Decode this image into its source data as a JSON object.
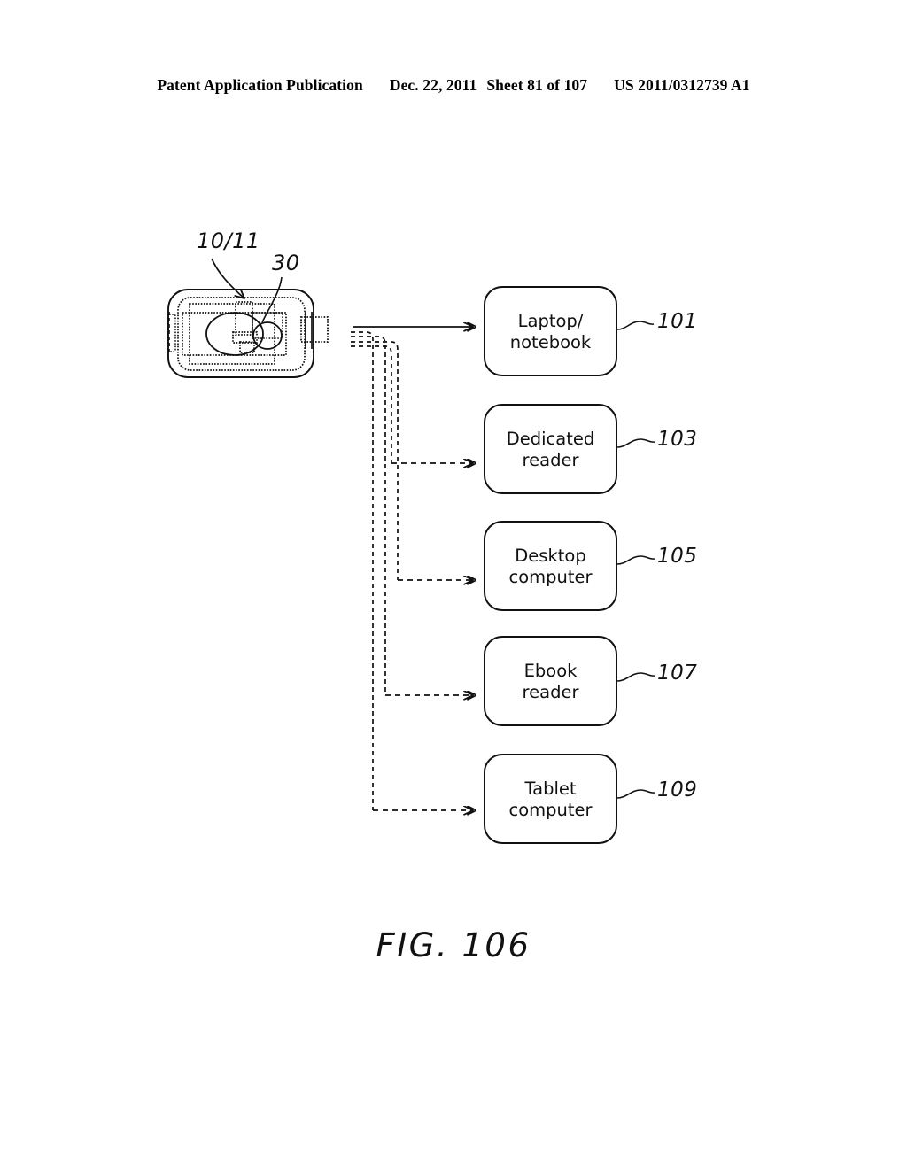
{
  "header": {
    "publication": "Patent Application Publication",
    "date": "Dec. 22, 2011",
    "sheet": "Sheet 81 of 107",
    "patent_number": "US 2011/0312739 A1"
  },
  "figure": {
    "caption": "FIG. 106",
    "source_device": {
      "ref_label": "10/11",
      "component_ref_label": "30",
      "name": "handheld-device"
    },
    "targets": [
      {
        "label": "Laptop/\nnotebook",
        "ref": "101",
        "link": "solid-arrow"
      },
      {
        "label": "Dedicated\nreader",
        "ref": "103",
        "link": "dashed-arrow"
      },
      {
        "label": "Desktop\ncomputer",
        "ref": "105",
        "link": "dashed-arrow"
      },
      {
        "label": "Ebook\nreader",
        "ref": "107",
        "link": "dashed-arrow"
      },
      {
        "label": "Tablet\ncomputer",
        "ref": "109",
        "link": "dashed-arrow"
      }
    ]
  },
  "colors": {
    "ink": "#111111",
    "page": "#ffffff"
  }
}
